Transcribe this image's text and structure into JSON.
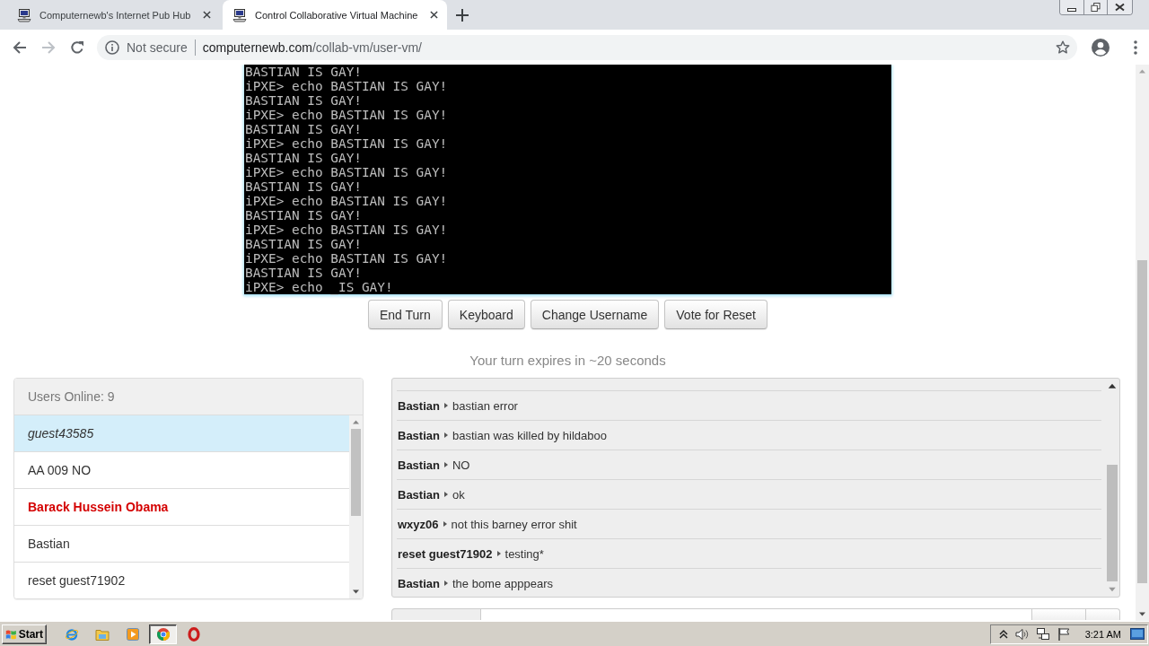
{
  "browser": {
    "tabs": [
      {
        "title": "Computernewb's Internet Pub Hub",
        "selected": false
      },
      {
        "title": "Control Collaborative Virtual Machine",
        "selected": true
      }
    ],
    "nav": [
      {
        "kind": "back",
        "disabled": false
      },
      {
        "kind": "forward",
        "disabled": true
      },
      {
        "kind": "reload",
        "disabled": false
      }
    ],
    "address": {
      "security": "Not secure",
      "domain": "computernewb.com",
      "path": "/collab-vm/user-vm/"
    }
  },
  "vm": {
    "lines": [
      "BASTIAN IS GAY!",
      "iPXE> echo BASTIAN IS GAY!",
      "BASTIAN IS GAY!",
      "iPXE> echo BASTIAN IS GAY!",
      "BASTIAN IS GAY!",
      "iPXE> echo BASTIAN IS GAY!",
      "BASTIAN IS GAY!",
      "iPXE> echo BASTIAN IS GAY!",
      "BASTIAN IS GAY!",
      "iPXE> echo BASTIAN IS GAY!",
      "BASTIAN IS GAY!",
      "iPXE> echo BASTIAN IS GAY!",
      "BASTIAN IS GAY!",
      "iPXE> echo BASTIAN IS GAY!",
      "BASTIAN IS GAY!",
      "iPXE> echo _IS GAY!"
    ]
  },
  "controls": {
    "buttons": [
      "End Turn",
      "Keyboard",
      "Change Username",
      "Vote for Reset"
    ],
    "turn_notice": "Your turn expires in ~20 seconds"
  },
  "users": {
    "header": "Users Online: 9",
    "items": [
      {
        "name": "guest43585",
        "kind": "self",
        "selected": true
      },
      {
        "name": "AA 009 NO",
        "kind": "user",
        "selected": false
      },
      {
        "name": "Barack Hussein Obama",
        "kind": "admin",
        "selected": false
      },
      {
        "name": "Bastian",
        "kind": "user",
        "selected": false
      },
      {
        "name": "reset guest71902",
        "kind": "user",
        "selected": false
      }
    ]
  },
  "chat": {
    "messages": [
      {
        "user": "Bastian",
        "text": "bastian error"
      },
      {
        "user": "Bastian",
        "text": "bastian was killed by hildaboo"
      },
      {
        "user": "Bastian",
        "text": "NO"
      },
      {
        "user": "Bastian",
        "text": "ok"
      },
      {
        "user": "wxyz06",
        "text": "not this barney error shit"
      },
      {
        "user": "reset guest71902",
        "text": "testing*"
      },
      {
        "user": "Bastian",
        "text": "the bome apppears"
      }
    ]
  },
  "taskbar": {
    "start": "Start",
    "apps": [
      {
        "kind": "globe",
        "selected": false
      },
      {
        "kind": "folder",
        "selected": false
      },
      {
        "kind": "player",
        "selected": false
      },
      {
        "kind": "wheel",
        "selected": true
      },
      {
        "kind": "ring",
        "selected": false
      }
    ],
    "clock": "3:21 AM"
  }
}
